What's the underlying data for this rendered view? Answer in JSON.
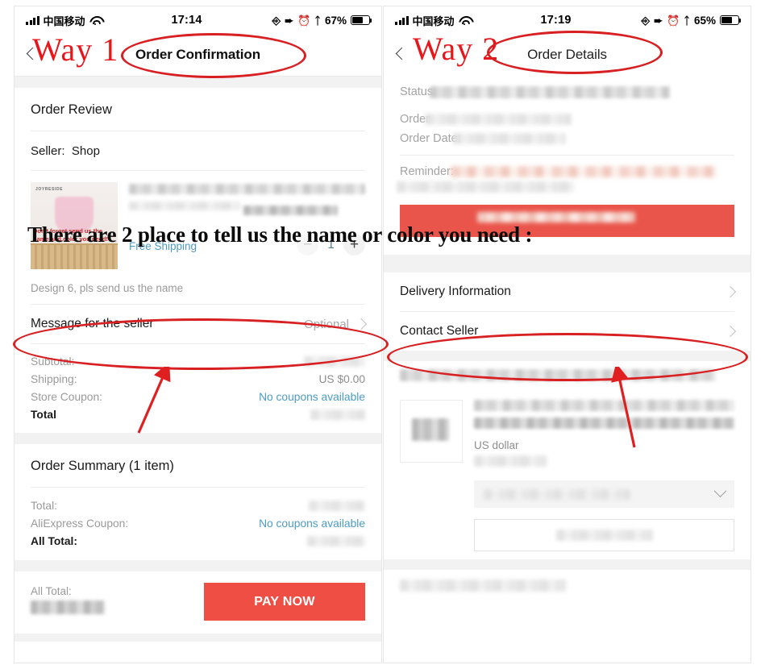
{
  "overlay": {
    "headline": "There are 2 place to tell us the name or color you need :",
    "way1_label": "Way 1",
    "way2_label": "Way 2",
    "annotation_color": "#d81f22",
    "way_text_color": "#e8161b"
  },
  "left_phone": {
    "status_bar": {
      "carrier": "中国移动",
      "time": "17:14",
      "battery_percent": "67%",
      "signal_icon": "signal-bars-icon",
      "wifi_icon": "wifi-icon",
      "rotation_lock_icon": "rotation-lock-icon",
      "location_icon": "location-arrow-icon",
      "alarm_icon": "alarm-clock-icon",
      "bluetooth_icon": "bluetooth-icon",
      "battery_icon": "battery-icon"
    },
    "nav": {
      "title": "Order Confirmation",
      "back_icon": "back-chevron-icon"
    },
    "order_review": {
      "section_title": "Order Review",
      "seller_label": "Seller:",
      "seller_name": "Shop",
      "product": {
        "thumb_brand": "JOYRESIDE",
        "thumb_note": "Don't forget send us the name and color you need!",
        "shipping_label": "Free Shipping",
        "quantity": "1",
        "minus_icon": "minus-icon",
        "plus_icon": "plus-icon",
        "custom_note": "Design 6, pls send us the name"
      },
      "message_row": {
        "label": "Message for the seller",
        "value": "Optional",
        "chevron_icon": "chevron-right-icon"
      },
      "totals": [
        {
          "key": "Subtotal:",
          "value": "",
          "blurred": true
        },
        {
          "key": "Shipping:",
          "value": "US $0.00",
          "blurred": false
        },
        {
          "key": "Store Coupon:",
          "value": "No coupons available",
          "link": true
        },
        {
          "key": "Total",
          "value": "",
          "blurred": true,
          "bold": true
        }
      ]
    },
    "order_summary": {
      "section_title": "Order Summary (1 item)",
      "rows": [
        {
          "key": "Total:",
          "value": "",
          "blurred": true
        },
        {
          "key": "AliExpress Coupon:",
          "value": "No coupons available",
          "link": true
        },
        {
          "key": "All Total:",
          "value": "",
          "blurred": true,
          "bold": true
        }
      ]
    },
    "footer": {
      "all_total_label": "All Total:",
      "pay_button": "PAY NOW",
      "pay_button_color": "#ef4e45"
    }
  },
  "right_phone": {
    "status_bar": {
      "carrier": "中国移动",
      "time": "17:19",
      "battery_percent": "65%",
      "signal_icon": "signal-bars-icon",
      "wifi_icon": "wifi-icon",
      "rotation_lock_icon": "rotation-lock-icon",
      "location_icon": "location-arrow-icon",
      "alarm_icon": "alarm-clock-icon",
      "bluetooth_icon": "bluetooth-icon",
      "battery_icon": "battery-icon"
    },
    "nav": {
      "title": "Order Details",
      "back_icon": "back-chevron-icon"
    },
    "status_block": {
      "status_label": "Status:",
      "order_label": "Order",
      "order_date_label": "Order Date:",
      "reminder_label": "Reminder:"
    },
    "links": [
      {
        "label": "Delivery Information",
        "chevron_icon": "chevron-right-icon"
      },
      {
        "label": "Contact Seller",
        "chevron_icon": "chevron-right-icon"
      }
    ],
    "item": {
      "currency_note": "US dollar",
      "dropdown_chevron_icon": "chevron-down-icon"
    }
  }
}
